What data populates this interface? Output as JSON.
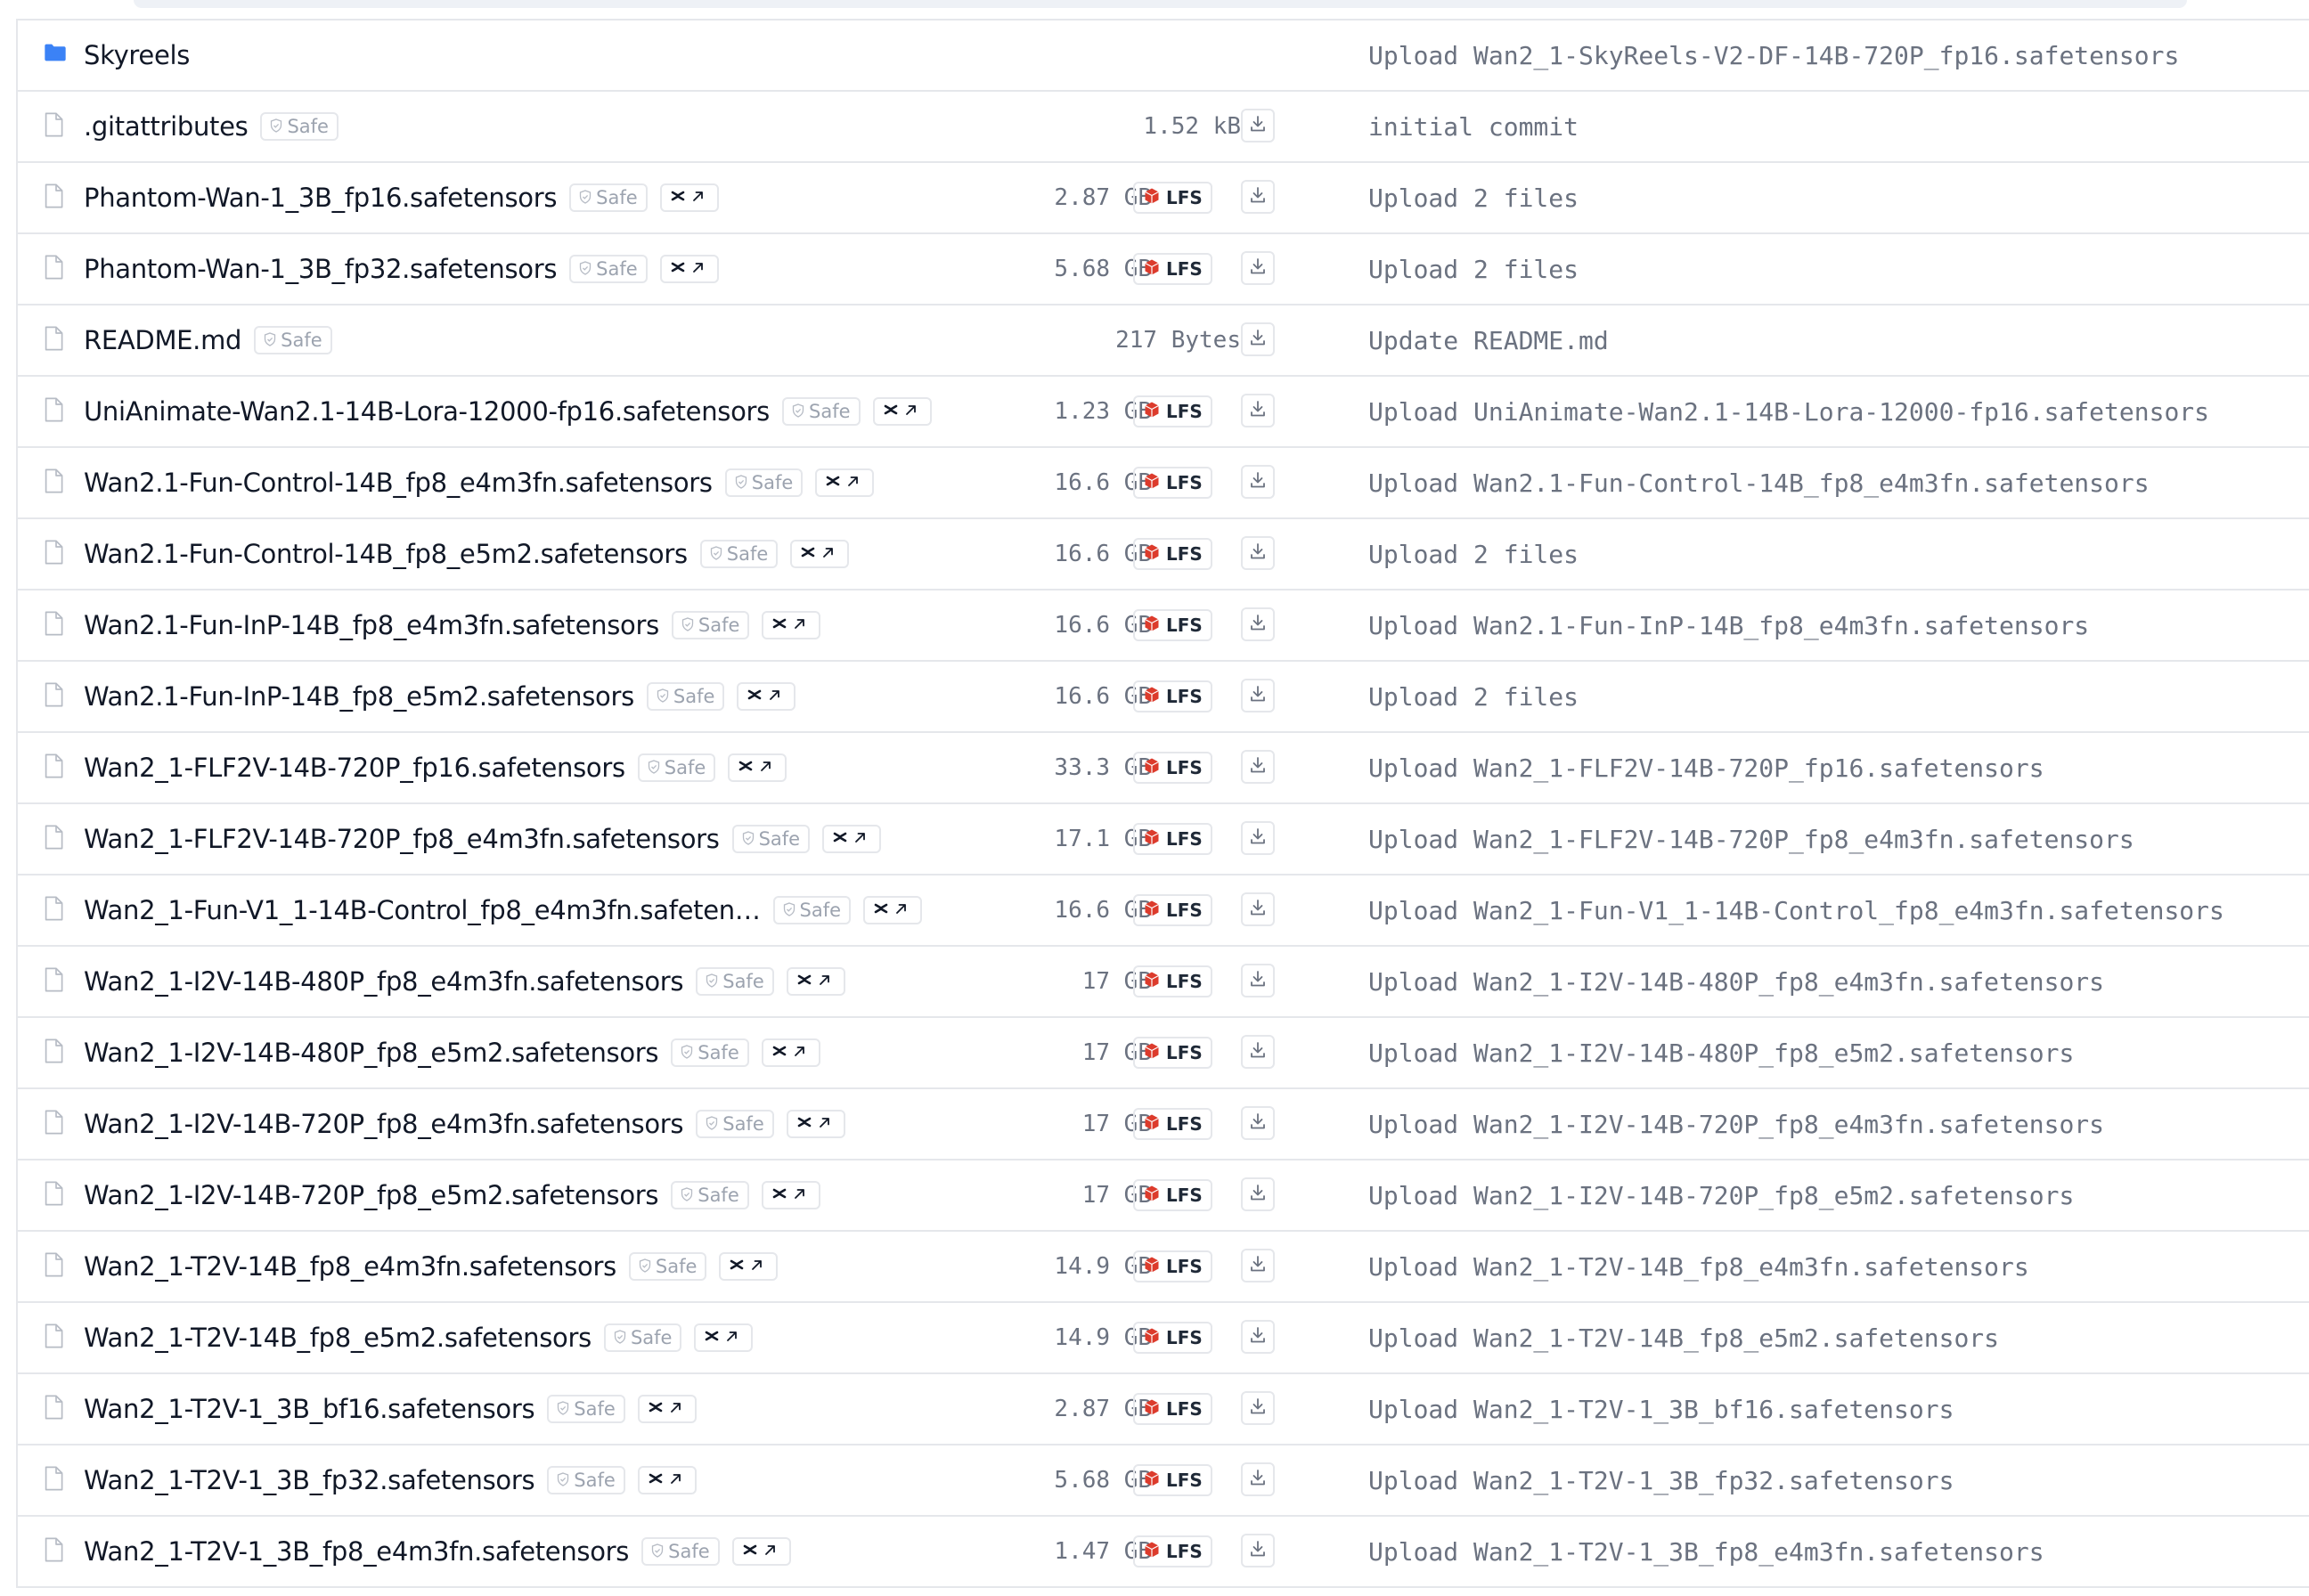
{
  "badges": {
    "safe": "Safe",
    "lfs": "LFS"
  },
  "icons": {
    "folder": "folder-icon",
    "file": "file-icon",
    "safe": "shield-check-icon",
    "xet": "xet-link-icon",
    "lfs": "lfs-cube-icon",
    "download": "download-icon"
  },
  "colors": {
    "folder": "#3b82f6",
    "lfs": "#dc3b2c",
    "border": "#e5e7eb"
  },
  "files": [
    {
      "name": "Skyreels",
      "type": "folder",
      "commit": "Upload Wan2_1-SkyReels-V2-DF-14B-720P_fp16.safetensors"
    },
    {
      "name": ".gitattributes",
      "type": "file",
      "safe": true,
      "xet": false,
      "size": "1.52 kB",
      "lfs": false,
      "commit": "initial commit"
    },
    {
      "name": "Phantom-Wan-1_3B_fp16.safetensors",
      "type": "file",
      "safe": true,
      "xet": true,
      "size": "2.87 GB",
      "lfs": true,
      "commit": "Upload 2 files"
    },
    {
      "name": "Phantom-Wan-1_3B_fp32.safetensors",
      "type": "file",
      "safe": true,
      "xet": true,
      "size": "5.68 GB",
      "lfs": true,
      "commit": "Upload 2 files"
    },
    {
      "name": "README.md",
      "type": "file",
      "safe": true,
      "xet": false,
      "size": "217 Bytes",
      "lfs": false,
      "commit": "Update README.md"
    },
    {
      "name": "UniAnimate-Wan2.1-14B-Lora-12000-fp16.safetensors",
      "type": "file",
      "safe": true,
      "xet": true,
      "size": "1.23 GB",
      "lfs": true,
      "commit": "Upload UniAnimate-Wan2.1-14B-Lora-12000-fp16.safetensors"
    },
    {
      "name": "Wan2.1-Fun-Control-14B_fp8_e4m3fn.safetensors",
      "type": "file",
      "safe": true,
      "xet": true,
      "size": "16.6 GB",
      "lfs": true,
      "commit": "Upload Wan2.1-Fun-Control-14B_fp8_e4m3fn.safetensors"
    },
    {
      "name": "Wan2.1-Fun-Control-14B_fp8_e5m2.safetensors",
      "type": "file",
      "safe": true,
      "xet": true,
      "size": "16.6 GB",
      "lfs": true,
      "commit": "Upload 2 files"
    },
    {
      "name": "Wan2.1-Fun-InP-14B_fp8_e4m3fn.safetensors",
      "type": "file",
      "safe": true,
      "xet": true,
      "size": "16.6 GB",
      "lfs": true,
      "commit": "Upload Wan2.1-Fun-InP-14B_fp8_e4m3fn.safetensors"
    },
    {
      "name": "Wan2.1-Fun-InP-14B_fp8_e5m2.safetensors",
      "type": "file",
      "safe": true,
      "xet": true,
      "size": "16.6 GB",
      "lfs": true,
      "commit": "Upload 2 files"
    },
    {
      "name": "Wan2_1-FLF2V-14B-720P_fp16.safetensors",
      "type": "file",
      "safe": true,
      "xet": true,
      "size": "33.3 GB",
      "lfs": true,
      "commit": "Upload Wan2_1-FLF2V-14B-720P_fp16.safetensors"
    },
    {
      "name": "Wan2_1-FLF2V-14B-720P_fp8_e4m3fn.safetensors",
      "type": "file",
      "safe": true,
      "xet": true,
      "size": "17.1 GB",
      "lfs": true,
      "commit": "Upload Wan2_1-FLF2V-14B-720P_fp8_e4m3fn.safetensors"
    },
    {
      "name": "Wan2_1-Fun-V1_1-14B-Control_fp8_e4m3fn.safeten…",
      "type": "file",
      "safe": true,
      "xet": true,
      "size": "16.6 GB",
      "lfs": true,
      "commit": "Upload Wan2_1-Fun-V1_1-14B-Control_fp8_e4m3fn.safetensors"
    },
    {
      "name": "Wan2_1-I2V-14B-480P_fp8_e4m3fn.safetensors",
      "type": "file",
      "safe": true,
      "xet": true,
      "size": "17 GB",
      "lfs": true,
      "commit": "Upload Wan2_1-I2V-14B-480P_fp8_e4m3fn.safetensors"
    },
    {
      "name": "Wan2_1-I2V-14B-480P_fp8_e5m2.safetensors",
      "type": "file",
      "safe": true,
      "xet": true,
      "size": "17 GB",
      "lfs": true,
      "commit": "Upload Wan2_1-I2V-14B-480P_fp8_e5m2.safetensors"
    },
    {
      "name": "Wan2_1-I2V-14B-720P_fp8_e4m3fn.safetensors",
      "type": "file",
      "safe": true,
      "xet": true,
      "size": "17 GB",
      "lfs": true,
      "commit": "Upload Wan2_1-I2V-14B-720P_fp8_e4m3fn.safetensors"
    },
    {
      "name": "Wan2_1-I2V-14B-720P_fp8_e5m2.safetensors",
      "type": "file",
      "safe": true,
      "xet": true,
      "size": "17 GB",
      "lfs": true,
      "commit": "Upload Wan2_1-I2V-14B-720P_fp8_e5m2.safetensors"
    },
    {
      "name": "Wan2_1-T2V-14B_fp8_e4m3fn.safetensors",
      "type": "file",
      "safe": true,
      "xet": true,
      "size": "14.9 GB",
      "lfs": true,
      "commit": "Upload Wan2_1-T2V-14B_fp8_e4m3fn.safetensors"
    },
    {
      "name": "Wan2_1-T2V-14B_fp8_e5m2.safetensors",
      "type": "file",
      "safe": true,
      "xet": true,
      "size": "14.9 GB",
      "lfs": true,
      "commit": "Upload Wan2_1-T2V-14B_fp8_e5m2.safetensors"
    },
    {
      "name": "Wan2_1-T2V-1_3B_bf16.safetensors",
      "type": "file",
      "safe": true,
      "xet": true,
      "size": "2.87 GB",
      "lfs": true,
      "commit": "Upload Wan2_1-T2V-1_3B_bf16.safetensors"
    },
    {
      "name": "Wan2_1-T2V-1_3B_fp32.safetensors",
      "type": "file",
      "safe": true,
      "xet": true,
      "size": "5.68 GB",
      "lfs": true,
      "commit": "Upload Wan2_1-T2V-1_3B_fp32.safetensors"
    },
    {
      "name": "Wan2_1-T2V-1_3B_fp8_e4m3fn.safetensors",
      "type": "file",
      "safe": true,
      "xet": true,
      "size": "1.47 GB",
      "lfs": true,
      "commit": "Upload Wan2_1-T2V-1_3B_fp8_e4m3fn.safetensors"
    }
  ]
}
